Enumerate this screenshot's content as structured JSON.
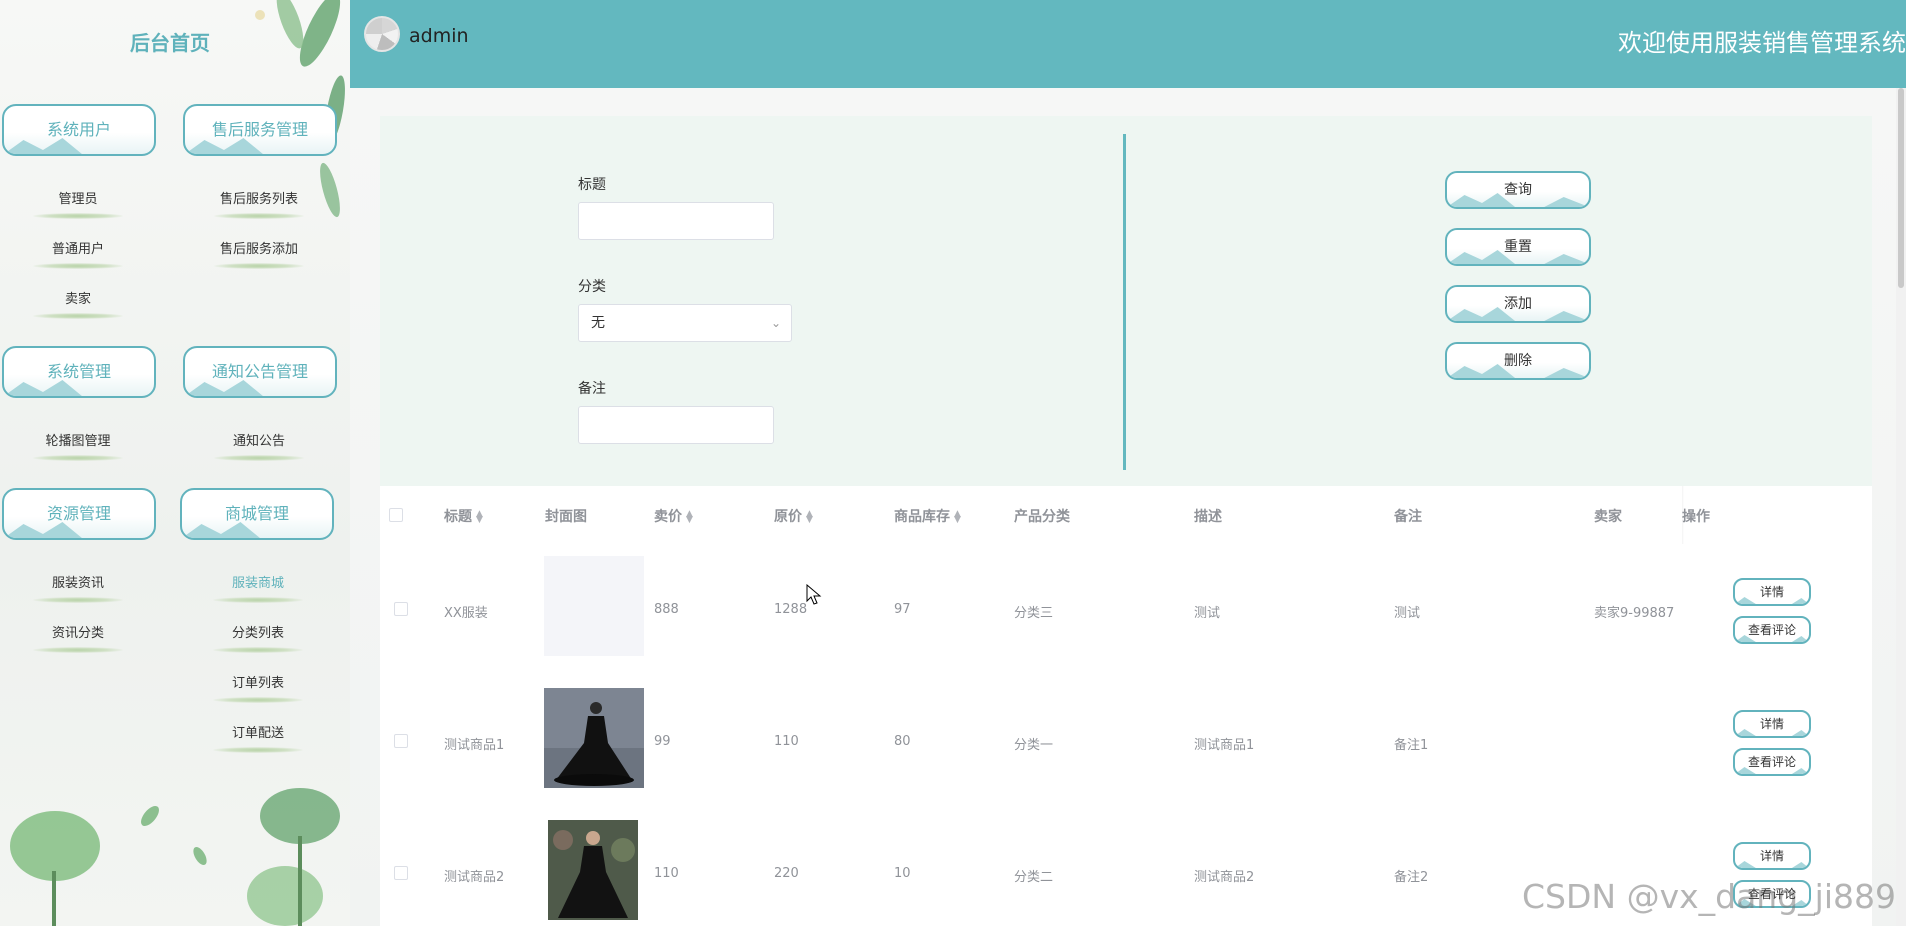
{
  "sidebar": {
    "home": "后台首页",
    "groups": [
      {
        "label": "系统用户",
        "items": [
          "管理员",
          "普通用户",
          "卖家"
        ]
      },
      {
        "label": "售后服务管理",
        "items": [
          "售后服务列表",
          "售后服务添加"
        ]
      },
      {
        "label": "系统管理",
        "items": [
          "轮播图管理"
        ]
      },
      {
        "label": "通知公告管理",
        "items": [
          "通知公告"
        ]
      },
      {
        "label": "资源管理",
        "items": [
          "服装资讯",
          "资讯分类"
        ]
      },
      {
        "label": "商城管理",
        "items": [
          "服装商城",
          "分类列表",
          "订单列表",
          "订单配送"
        ]
      }
    ],
    "active_item": "服装商城"
  },
  "header": {
    "username": "admin",
    "title": "欢迎使用服装销售管理系统"
  },
  "search": {
    "title_label": "标题",
    "title_value": "",
    "category_label": "分类",
    "category_value": "无",
    "remark_label": "备注",
    "remark_value": "",
    "buttons": {
      "query": "查询",
      "reset": "重置",
      "add": "添加",
      "delete": "删除"
    }
  },
  "table": {
    "columns": [
      "标题",
      "封面图",
      "卖价",
      "原价",
      "商品库存",
      "产品分类",
      "描述",
      "备注",
      "卖家",
      "操作"
    ],
    "rows": [
      {
        "title": "XX服装",
        "price": "888",
        "original_price": "1288",
        "stock": "97",
        "category": "分类三",
        "desc": "测试",
        "remark": "测试",
        "seller": "卖家9-99887",
        "cover": "blank"
      },
      {
        "title": "测试商品1",
        "price": "99",
        "original_price": "110",
        "stock": "80",
        "category": "分类一",
        "desc": "测试商品1",
        "remark": "备注1",
        "seller": "",
        "cover": "black-gown"
      },
      {
        "title": "测试商品2",
        "price": "110",
        "original_price": "220",
        "stock": "10",
        "category": "分类二",
        "desc": "测试商品2",
        "remark": "备注2",
        "seller": "",
        "cover": "black-dress-woman"
      }
    ],
    "op_buttons": {
      "detail": "详情",
      "comments": "查看评论"
    }
  },
  "watermark": "CSDN @vx_dang_ji889",
  "colors": {
    "accent": "#63b8bf",
    "panel": "#eef6f2"
  }
}
